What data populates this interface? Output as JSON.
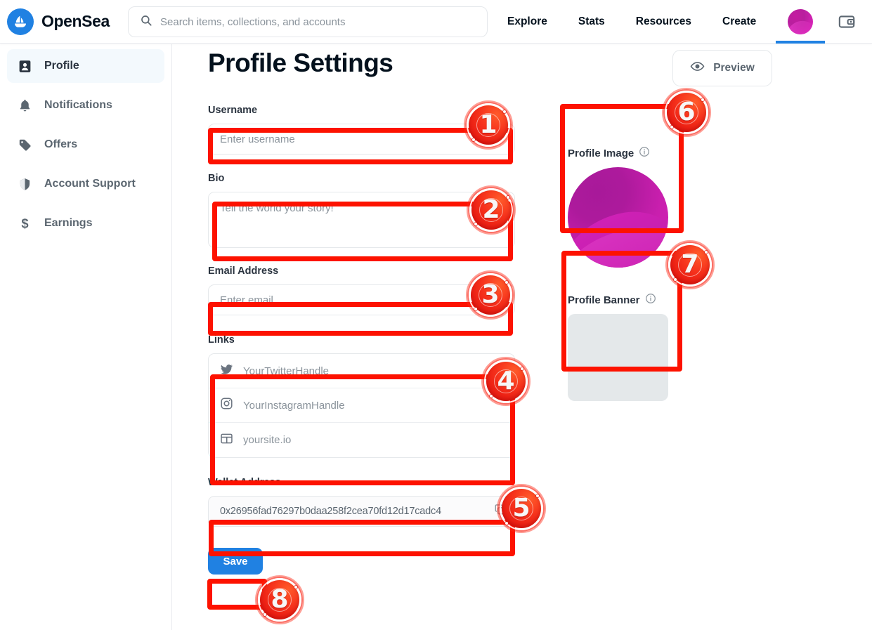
{
  "header": {
    "brand_name": "OpenSea",
    "logo_icon": "opensea-sailboat-logo",
    "search": {
      "placeholder": "Search items, collections, and accounts",
      "icon": "search-icon"
    },
    "nav_items": [
      {
        "label": "Explore"
      },
      {
        "label": "Stats"
      },
      {
        "label": "Resources"
      },
      {
        "label": "Create"
      }
    ],
    "avatar_icon": "user-avatar",
    "wallet_icon": "wallet-icon",
    "accent_color": "#2081e2"
  },
  "sidebar": {
    "items": [
      {
        "label": "Profile",
        "icon": "profile-icon",
        "active": true
      },
      {
        "label": "Notifications",
        "icon": "bell-icon",
        "active": false
      },
      {
        "label": "Offers",
        "icon": "tag-icon",
        "active": false
      },
      {
        "label": "Account Support",
        "icon": "shield-icon",
        "active": false
      },
      {
        "label": "Earnings",
        "icon": "dollar-icon",
        "active": false
      }
    ]
  },
  "main": {
    "page_title": "Profile Settings",
    "preview_button": {
      "label": "Preview",
      "icon": "eye-icon"
    },
    "fields": {
      "username": {
        "label": "Username",
        "placeholder": "Enter username",
        "value": ""
      },
      "bio": {
        "label": "Bio",
        "placeholder": "Tell the world your story!",
        "value": ""
      },
      "email": {
        "label": "Email Address",
        "placeholder": "Enter email",
        "value": ""
      },
      "links": {
        "label": "Links",
        "rows": [
          {
            "icon": "twitter-icon",
            "placeholder": "YourTwitterHandle",
            "value": ""
          },
          {
            "icon": "instagram-icon",
            "placeholder": "YourInstagramHandle",
            "value": ""
          },
          {
            "icon": "website-icon",
            "placeholder": "yoursite.io",
            "value": ""
          }
        ]
      },
      "wallet": {
        "label": "Wallet Address",
        "value": "0x26956fad76297b0daa258f2cea70fd12d17cadc4",
        "copy_icon": "copy-icon"
      }
    },
    "save_button": {
      "label": "Save",
      "color": "#2081e2"
    },
    "media": {
      "profile_image": {
        "label": "Profile Image",
        "info_icon": "info-icon"
      },
      "profile_banner": {
        "label": "Profile Banner",
        "info_icon": "info-icon"
      }
    }
  },
  "annotations": [
    {
      "number": "1",
      "target": "username-input"
    },
    {
      "number": "2",
      "target": "bio-textarea"
    },
    {
      "number": "3",
      "target": "email-input"
    },
    {
      "number": "4",
      "target": "links-group"
    },
    {
      "number": "5",
      "target": "wallet-address-input"
    },
    {
      "number": "6",
      "target": "profile-image-block"
    },
    {
      "number": "7",
      "target": "profile-banner-block"
    },
    {
      "number": "8",
      "target": "save-button"
    }
  ]
}
